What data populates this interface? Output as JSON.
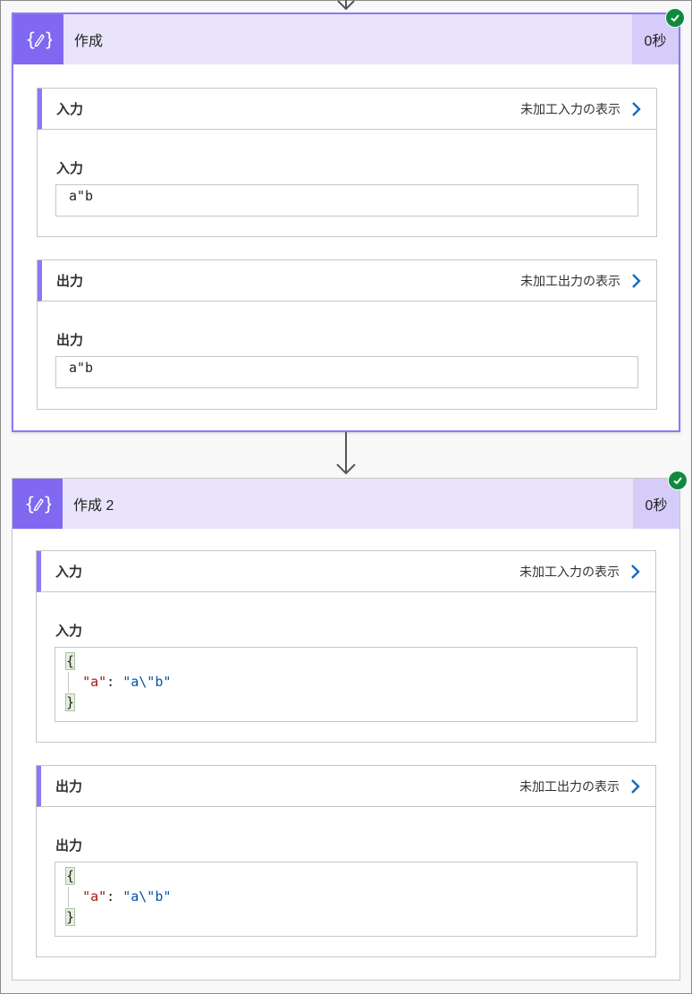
{
  "actions": [
    {
      "title": "作成",
      "duration": "0秒",
      "inputs": {
        "section_title": "入力",
        "raw_link": "未加工入力の表示",
        "field_label": "入力",
        "value": "a\"b"
      },
      "outputs": {
        "section_title": "出力",
        "raw_link": "未加工出力の表示",
        "field_label": "出力",
        "value": "a\"b"
      }
    },
    {
      "title": "作成 2",
      "duration": "0秒",
      "inputs": {
        "section_title": "入力",
        "raw_link": "未加工入力の表示",
        "field_label": "入力",
        "json": {
          "open": "{",
          "key": "\"a\"",
          "sep": ": ",
          "value": "\"a\\\"b\"",
          "close": "}"
        }
      },
      "outputs": {
        "section_title": "出力",
        "raw_link": "未加工出力の表示",
        "field_label": "出力",
        "json": {
          "open": "{",
          "key": "\"a\"",
          "sep": ": ",
          "value": "\"a\\\"b\"",
          "close": "}"
        }
      }
    }
  ],
  "colors": {
    "accent": "#8068f0",
    "header_bg": "#e9e4fc",
    "success": "#128a3e",
    "link_chevron": "#0f6cbd",
    "json_key": "#a31515",
    "json_string": "#0451a5"
  },
  "icons": {
    "action_icon": "compose-braces-pencil-icon",
    "status_icon": "success-check-icon",
    "chevron_icon": "chevron-right-icon",
    "flow_arrow": "down-arrow-icon"
  }
}
